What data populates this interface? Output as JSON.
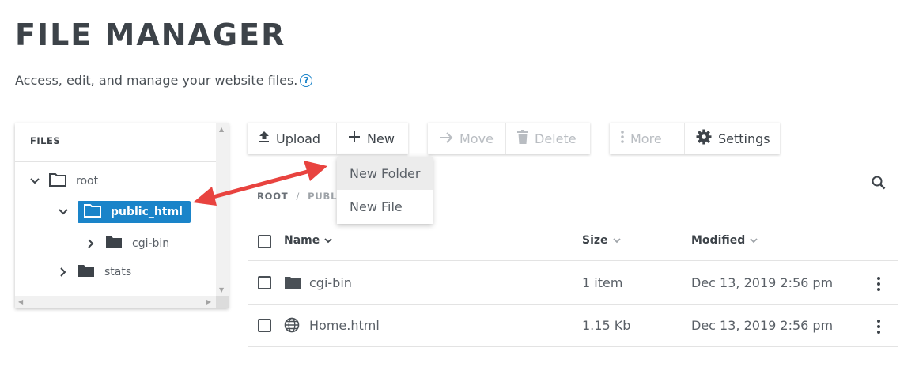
{
  "page": {
    "title": "FILE MANAGER",
    "subtitle": "Access, edit, and manage your website files.",
    "help_icon": "question-circle-icon"
  },
  "tree": {
    "header": "FILES",
    "nodes": [
      {
        "label": "root",
        "expanded": true,
        "icon": "folder-outline-icon"
      },
      {
        "label": "public_html",
        "expanded": true,
        "selected": true,
        "icon": "folder-outline-icon"
      },
      {
        "label": "cgi-bin",
        "expanded": false,
        "icon": "folder-filled-icon"
      },
      {
        "label": "stats",
        "expanded": false,
        "icon": "folder-filled-icon"
      }
    ]
  },
  "toolbar": {
    "upload": "Upload",
    "new": "New",
    "move": "Move",
    "delete": "Delete",
    "more": "More",
    "settings": "Settings"
  },
  "new_menu": {
    "items": [
      "New Folder",
      "New File"
    ]
  },
  "breadcrumb": {
    "root": "ROOT",
    "separator": "/",
    "current": "PUBL"
  },
  "table": {
    "columns": {
      "name": "Name",
      "size": "Size",
      "modified": "Modified"
    },
    "rows": [
      {
        "name": "cgi-bin",
        "type": "folder",
        "size": "1 item",
        "modified": "Dec 13, 2019 2:56 pm"
      },
      {
        "name": "Home.html",
        "type": "web-file",
        "size": "1.15 Kb",
        "modified": "Dec 13, 2019 2:56 pm"
      }
    ]
  },
  "colors": {
    "accent": "#1a84c9",
    "annotation_arrow": "#e8433f",
    "text": "#3d4349"
  }
}
